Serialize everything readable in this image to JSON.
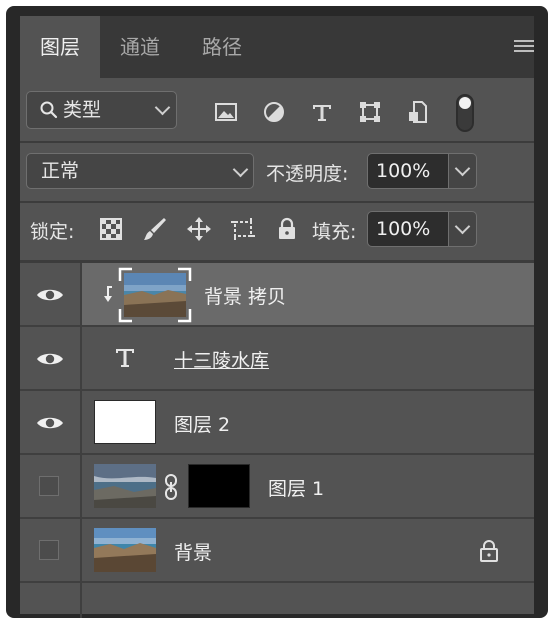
{
  "tabs": [
    {
      "label": "图层",
      "active": true
    },
    {
      "label": "通道",
      "active": false
    },
    {
      "label": "路径",
      "active": false
    }
  ],
  "filter": {
    "kind_label": "类型",
    "filter_icons": [
      "image-filter-icon",
      "adjustment-filter-icon",
      "type-filter-icon",
      "shape-filter-icon",
      "smart-object-filter-icon"
    ]
  },
  "blend": {
    "mode": "正常",
    "opacity_label": "不透明度:",
    "opacity_value": "100%"
  },
  "lock": {
    "label": "锁定:",
    "fill_label": "填充:",
    "fill_value": "100%"
  },
  "layers": [
    {
      "name": "背景 拷贝",
      "visible": true,
      "selected": true,
      "type": "clipped-image"
    },
    {
      "name": "十三陵水库",
      "visible": true,
      "selected": false,
      "type": "text"
    },
    {
      "name": "图层 2",
      "visible": true,
      "selected": false,
      "type": "white"
    },
    {
      "name": "图层 1",
      "visible": false,
      "selected": false,
      "type": "masked-image"
    },
    {
      "name": "背景",
      "visible": false,
      "selected": false,
      "type": "background",
      "locked": true
    }
  ],
  "colors": {
    "panel_bg": "#535353",
    "tab_bar_bg": "#383838",
    "selected_row": "#6a6a6a",
    "window_frame": "#282828"
  }
}
